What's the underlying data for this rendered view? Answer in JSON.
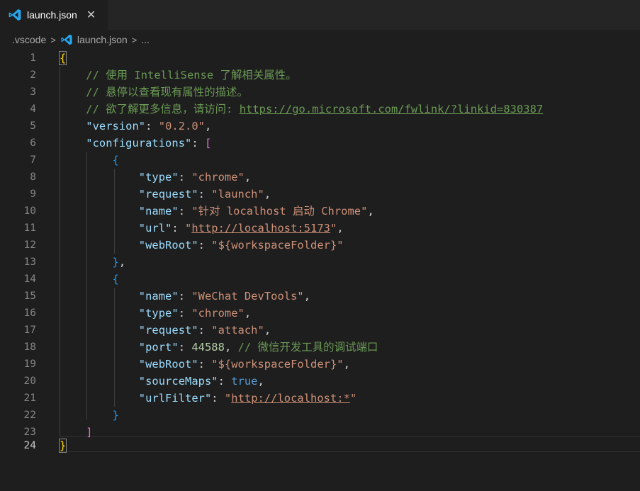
{
  "tab": {
    "label": "launch.json",
    "icon": "vscode-icon",
    "close_glyph": "✕"
  },
  "breadcrumb": {
    "folder": ".vscode",
    "file": "launch.json",
    "more": "..."
  },
  "line_numbers": [
    "1",
    "2",
    "3",
    "4",
    "5",
    "6",
    "7",
    "8",
    "9",
    "10",
    "11",
    "12",
    "13",
    "14",
    "15",
    "16",
    "17",
    "18",
    "19",
    "20",
    "21",
    "22",
    "23",
    "24"
  ],
  "code": {
    "l1": {
      "brace": "{"
    },
    "l2": {
      "comment": "// 使用 IntelliSense 了解相关属性。"
    },
    "l3": {
      "comment": "// 悬停以查看现有属性的描述。"
    },
    "l4": {
      "comment": "// 欲了解更多信息，请访问: ",
      "link": "https://go.microsoft.com/fwlink/?linkid=830387"
    },
    "l5": {
      "key": "\"version\"",
      "value": "\"0.2.0\""
    },
    "l6": {
      "key": "\"configurations\"",
      "bracket": "["
    },
    "l7": {
      "brace": "{"
    },
    "l8": {
      "key": "\"type\"",
      "value": "\"chrome\""
    },
    "l9": {
      "key": "\"request\"",
      "value": "\"launch\""
    },
    "l10": {
      "key": "\"name\"",
      "value": "\"针对 localhost 启动 Chrome\""
    },
    "l11": {
      "key": "\"url\"",
      "q1": "\"",
      "link": "http://localhost:5173",
      "q2": "\""
    },
    "l12": {
      "key": "\"webRoot\"",
      "value": "\"${workspaceFolder}\""
    },
    "l13": {
      "brace": "}"
    },
    "l14": {
      "brace": "{"
    },
    "l15": {
      "key": "\"name\"",
      "value": "\"WeChat DevTools\""
    },
    "l16": {
      "key": "\"type\"",
      "value": "\"chrome\""
    },
    "l17": {
      "key": "\"request\"",
      "value": "\"attach\""
    },
    "l18": {
      "key": "\"port\"",
      "number": "44588",
      "comment": "// 微信开发工具的调试端口"
    },
    "l19": {
      "key": "\"webRoot\"",
      "value": "\"${workspaceFolder}\""
    },
    "l20": {
      "key": "\"sourceMaps\"",
      "bool": "true"
    },
    "l21": {
      "key": "\"urlFilter\"",
      "q1": "\"",
      "link": "http://localhost:*",
      "q2": "\""
    },
    "l22": {
      "brace": "}"
    },
    "l23": {
      "bracket": "]"
    },
    "l24": {
      "brace": "}"
    }
  },
  "colors": {
    "background": "#1e1e1e",
    "key": "#9cdcfe",
    "string": "#ce9178",
    "comment": "#6a9955",
    "number": "#b5cea8",
    "keyword": "#569cd6",
    "vscode_blue": "#23a9f2"
  }
}
